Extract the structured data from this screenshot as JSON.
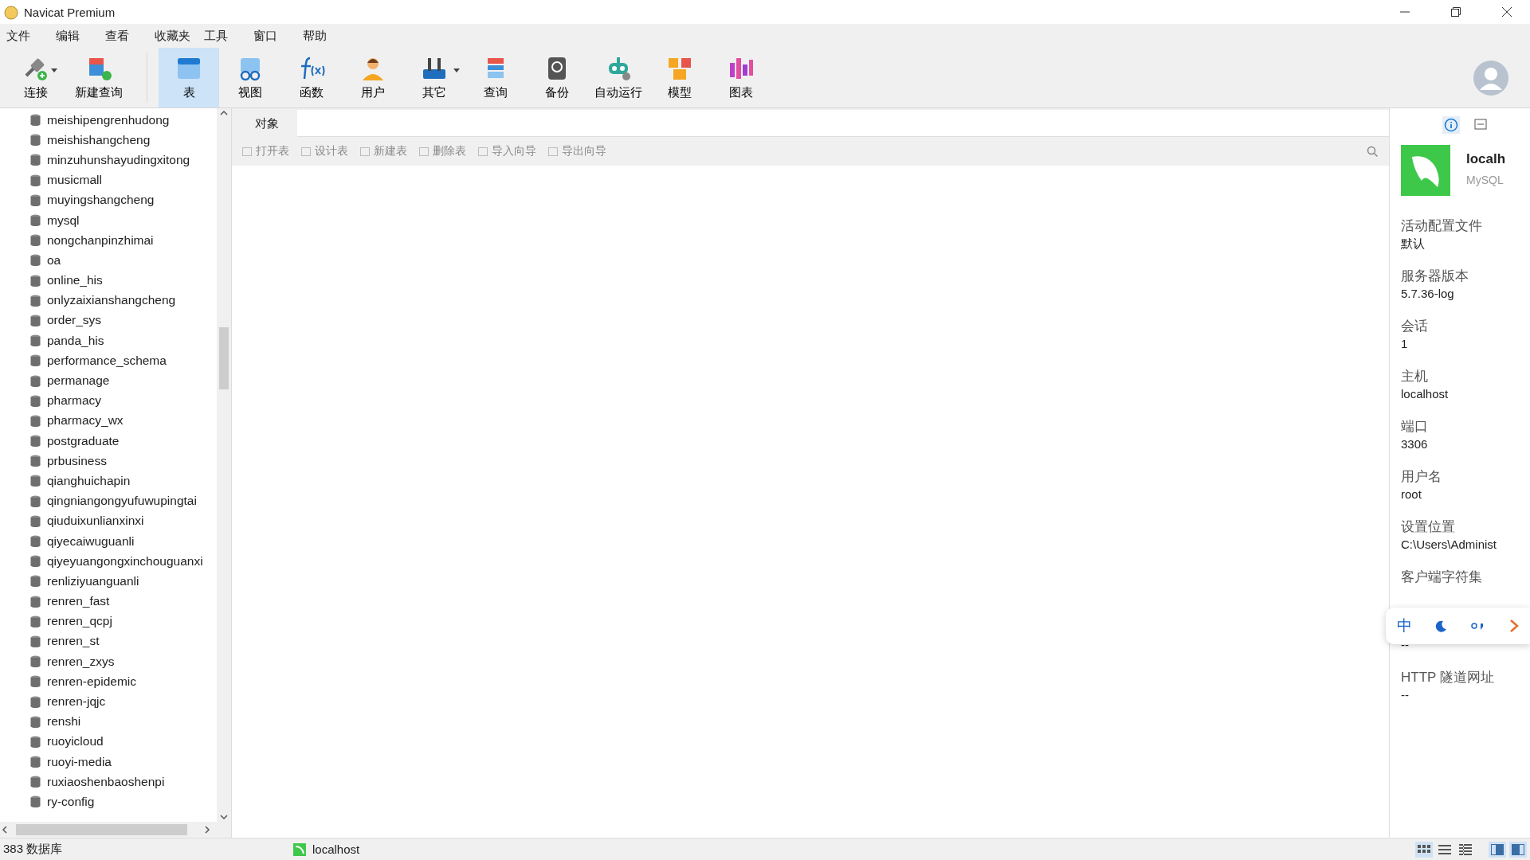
{
  "window": {
    "title": "Navicat Premium"
  },
  "menu": [
    "文件",
    "编辑",
    "查看",
    "收藏夹",
    "工具",
    "窗口",
    "帮助"
  ],
  "toolbar": [
    {
      "label": "连接",
      "selected": false,
      "dropdown": true
    },
    {
      "label": "新建查询",
      "selected": false,
      "dropdown": false
    },
    {
      "label": "表",
      "selected": true,
      "dropdown": false
    },
    {
      "label": "视图",
      "selected": false,
      "dropdown": false
    },
    {
      "label": "函数",
      "selected": false,
      "dropdown": false
    },
    {
      "label": "用户",
      "selected": false,
      "dropdown": false
    },
    {
      "label": "其它",
      "selected": false,
      "dropdown": true
    },
    {
      "label": "查询",
      "selected": false,
      "dropdown": false
    },
    {
      "label": "备份",
      "selected": false,
      "dropdown": false
    },
    {
      "label": "自动运行",
      "selected": false,
      "dropdown": false
    },
    {
      "label": "模型",
      "selected": false,
      "dropdown": false
    },
    {
      "label": "图表",
      "selected": false,
      "dropdown": false
    }
  ],
  "sidebar": {
    "items": [
      "meishipengrenhudong",
      "meishishangcheng",
      "minzuhunshayudingxitong",
      "musicmall",
      "muyingshangcheng",
      "mysql",
      "nongchanpinzhimai",
      "oa",
      "online_his",
      "onlyzaixianshangcheng",
      "order_sys",
      "panda_his",
      "performance_schema",
      "permanage",
      "pharmacy",
      "pharmacy_wx",
      "postgraduate",
      "prbusiness",
      "qianghuichapin",
      "qingniangongyufuwupingtai",
      "qiuduixunlianxinxi",
      "qiyecaiwuguanli",
      "qiyeyuangongxinchouguanxi",
      "renliziyuanguanli",
      "renren_fast",
      "renren_qcpj",
      "renren_st",
      "renren_zxys",
      "renren-epidemic",
      "renren-jqjc",
      "renshi",
      "ruoyicloud",
      "ruoyi-media",
      "ruxiaoshenbaoshenpi",
      "ry-config"
    ]
  },
  "object_tab": {
    "label": "对象",
    "selected": true
  },
  "object_actions": [
    {
      "label": "打开表",
      "disabled": true
    },
    {
      "label": "设计表",
      "disabled": true
    },
    {
      "label": "新建表",
      "disabled": true
    },
    {
      "label": "删除表",
      "disabled": true
    },
    {
      "label": "导入向导",
      "disabled": true
    },
    {
      "label": "导出向导",
      "disabled": true
    }
  ],
  "info_panel": {
    "tabs": [
      {
        "kind": "info",
        "selected": true
      },
      {
        "kind": "ddl",
        "selected": false
      }
    ],
    "name": "localh",
    "type": "MySQL",
    "fields": [
      {
        "label": "活动配置文件",
        "value": "默认"
      },
      {
        "label": "服务器版本",
        "value": "5.7.36-log"
      },
      {
        "label": "会话",
        "value": "1"
      },
      {
        "label": "主机",
        "value": "localhost"
      },
      {
        "label": "端口",
        "value": "3306"
      },
      {
        "label": "用户名",
        "value": "root"
      },
      {
        "label": "设置位置",
        "value": "C:\\Users\\Administ"
      },
      {
        "label": "客户端字符集"
      },
      {
        "value": "--"
      },
      {
        "label": "HTTP 隧道网址",
        "value": "--"
      }
    ]
  },
  "ime_bar": {
    "mode": "中"
  },
  "status_bar": {
    "count": "383 数据库",
    "connection": "localhost",
    "views": [
      {
        "kind": "grid",
        "selected": true
      },
      {
        "kind": "list",
        "selected": false
      },
      {
        "kind": "detail",
        "selected": false
      }
    ],
    "panes": [
      {
        "kind": "left",
        "selected": true
      },
      {
        "kind": "right",
        "selected": true
      }
    ]
  }
}
